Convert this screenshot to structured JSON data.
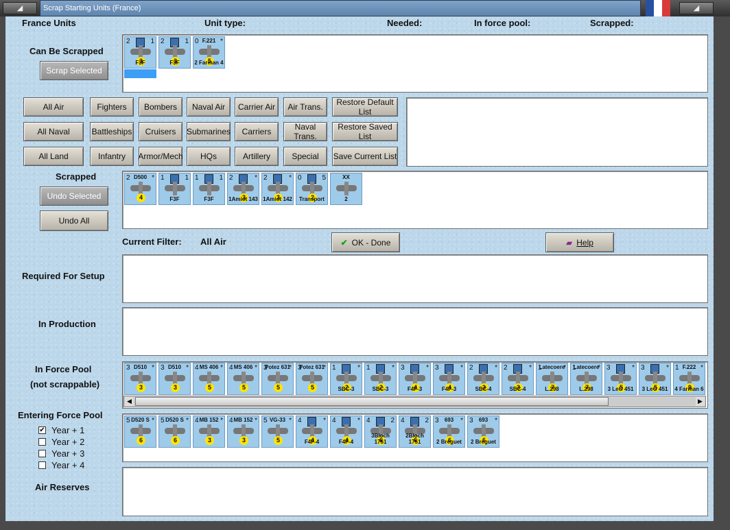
{
  "window": {
    "title": "Scrap Starting Units (France)"
  },
  "headers": {
    "units": "France Units",
    "unit_type": "Unit type:",
    "needed": "Needed:",
    "in_force_pool": "In force pool:",
    "scrapped": "Scrapped:"
  },
  "sections": {
    "can_be_scrapped": "Can Be Scrapped",
    "scrapped": "Scrapped",
    "current_filter_label": "Current Filter:",
    "current_filter_value": "All Air",
    "required_for_setup": "Required For Setup",
    "in_production": "In Production",
    "in_force_pool": "In Force Pool",
    "not_scrappable": "(not scrappable)",
    "entering_force_pool": "Entering Force Pool",
    "air_reserves": "Air Reserves"
  },
  "buttons": {
    "scrap_selected": "Scrap Selected",
    "undo_selected": "Undo Selected",
    "undo_all": "Undo All",
    "ok_done": "OK - Done",
    "help": "Help"
  },
  "filters": {
    "row1": [
      "All Air",
      "Fighters",
      "Bombers",
      "Naval Air",
      "Carrier Air",
      "Air Trans.",
      "Restore Default List"
    ],
    "row2": [
      "All Naval",
      "Battleships",
      "Cruisers",
      "Submarines",
      "Carriers",
      "Naval Trans.",
      "Restore Saved List"
    ],
    "row3": [
      "All Land",
      "Infantry",
      "Armor/Mech",
      "HQs",
      "Artillery",
      "Special",
      "Save Current List"
    ]
  },
  "years": [
    {
      "label": "Year + 1",
      "checked": true
    },
    {
      "label": "Year + 2",
      "checked": false
    },
    {
      "label": "Year + 3",
      "checked": false
    },
    {
      "label": "Year + 4",
      "checked": false
    }
  ],
  "can_be_scrapped_units": [
    {
      "tl": "2",
      "tr": "1",
      "name": "F3F",
      "badge": "3"
    },
    {
      "tl": "2",
      "tr": "1",
      "name": "F3F",
      "badge": "3"
    },
    {
      "tl": "0",
      "tr": "*",
      "name": "2 Farman 4",
      "badge": "5",
      "top": "F.221"
    }
  ],
  "scrapped_units": [
    {
      "tl": "2",
      "tr": "*",
      "name": "",
      "badge": "4",
      "top": "D500"
    },
    {
      "tl": "1",
      "tr": "1",
      "name": "F3F",
      "badge": ""
    },
    {
      "tl": "1",
      "tr": "1",
      "name": "F3F",
      "badge": ""
    },
    {
      "tl": "2",
      "tr": "*",
      "name": "1Amiot 143",
      "badge": "3"
    },
    {
      "tl": "2",
      "tr": "*",
      "name": "1Amiot 142",
      "badge": "3"
    },
    {
      "tl": "0",
      "tr": "5",
      "name": "Transport",
      "badge": "2",
      "top": ""
    },
    {
      "tl": "",
      "tr": "",
      "name": "2",
      "badge": "",
      "top": "XX"
    }
  ],
  "force_pool_units": [
    {
      "tl": "3",
      "tr": "*",
      "top": "D510",
      "badge": "3"
    },
    {
      "tl": "3",
      "tr": "*",
      "top": "D510",
      "badge": "3"
    },
    {
      "tl": "4",
      "tr": "*",
      "top": "MS 406",
      "badge": "5"
    },
    {
      "tl": "4",
      "tr": "*",
      "top": "MS 406",
      "badge": "5"
    },
    {
      "tl": "3",
      "tr": "*",
      "top": "Potez 631",
      "badge": "5"
    },
    {
      "tl": "3",
      "tr": "*",
      "top": "Potez 631",
      "badge": "5"
    },
    {
      "tl": "1",
      "tr": "*",
      "name": "SBC-3",
      "badge": "2"
    },
    {
      "tl": "1",
      "tr": "*",
      "name": "SBC-3",
      "badge": "2"
    },
    {
      "tl": "3",
      "tr": "*",
      "name": "F4F-3",
      "badge": "4"
    },
    {
      "tl": "3",
      "tr": "*",
      "name": "F4F-3",
      "badge": "4"
    },
    {
      "tl": "2",
      "tr": "*",
      "name": "SBC-4",
      "badge": "3"
    },
    {
      "tl": "2",
      "tr": "*",
      "name": "SBC-4",
      "badge": "3"
    },
    {
      "tl": "1",
      "tr": "*",
      "name": "L.298",
      "badge": "7",
      "top": "Latecoere"
    },
    {
      "tl": "1",
      "tr": "*",
      "name": "L.298",
      "badge": "7",
      "top": "Latecoere"
    },
    {
      "tl": "3",
      "tr": "*",
      "name": "3 LeO 451",
      "badge": "5"
    },
    {
      "tl": "3",
      "tr": "*",
      "name": "3 LeO 451",
      "badge": "5"
    },
    {
      "tl": "1",
      "tr": "*",
      "name": "4 Farman 6",
      "badge": "9",
      "top": "F.222"
    }
  ],
  "entering_units": [
    {
      "tl": "5",
      "tr": "*",
      "top": "D520 S",
      "badge": "6"
    },
    {
      "tl": "5",
      "tr": "*",
      "top": "D520 S",
      "badge": "6"
    },
    {
      "tl": "4",
      "tr": "*",
      "top": "MB 152",
      "badge": "3"
    },
    {
      "tl": "4",
      "tr": "*",
      "top": "MB 152",
      "badge": "3"
    },
    {
      "tl": "5",
      "tr": "*",
      "top": "VG-33",
      "badge": "5"
    },
    {
      "tl": "4",
      "tr": "*",
      "name": "F4F-4",
      "badge": "4"
    },
    {
      "tl": "4",
      "tr": "*",
      "name": "F4F-4",
      "badge": "4"
    },
    {
      "tl": "4",
      "tr": "2",
      "name": "3Bloch 1751",
      "badge": "6"
    },
    {
      "tl": "4",
      "tr": "2",
      "name": "2Bloch 1751",
      "badge": "6"
    },
    {
      "tl": "3",
      "tr": "*",
      "name": "2 Breguet",
      "badge": "6",
      "top": "693"
    },
    {
      "tl": "3",
      "tr": "*",
      "name": "2 Breguet",
      "badge": "6",
      "top": "693"
    }
  ],
  "colors": {
    "panel": "#bcd7ea",
    "unit": "#9fcbea",
    "badge": "#ffe400"
  }
}
